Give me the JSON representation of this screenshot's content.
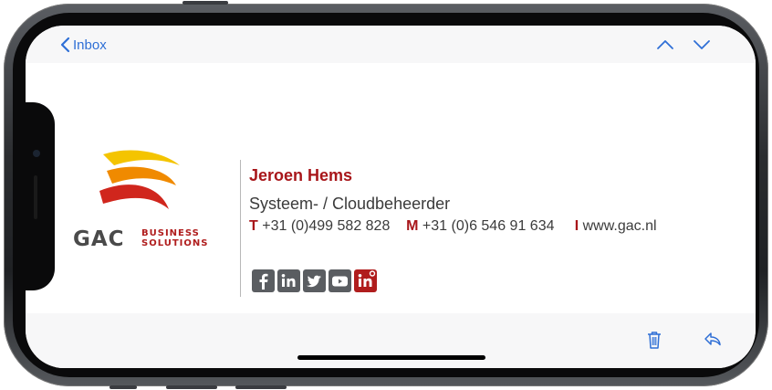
{
  "header": {
    "back_label": "Inbox"
  },
  "signature": {
    "name": "Jeroen Hems",
    "role": "Systeem- / Cloudbeheerder",
    "phone_key": "T",
    "phone": "+31 (0)499 582 828",
    "mobile_key": "M",
    "mobile": "+31 (0)6 546 91 634",
    "web_key": "I",
    "web": "www.gac.nl",
    "logo": {
      "main": "GAC",
      "sub_line1": "BUSINESS",
      "sub_line2": "SOLUTIONS"
    },
    "social": [
      {
        "icon": "facebook-icon",
        "color": "#5a5d61"
      },
      {
        "icon": "linkedin-icon",
        "color": "#5a5d61"
      },
      {
        "icon": "twitter-icon",
        "color": "#5a5d61"
      },
      {
        "icon": "youtube-icon",
        "color": "#5a5d61"
      },
      {
        "icon": "linkedin-company-icon",
        "color": "#b01d1d"
      }
    ]
  },
  "toolbar": {
    "trash_icon": "trash-icon",
    "reply_icon": "reply-icon"
  },
  "colors": {
    "accent": "#2f6fd6",
    "brand_red": "#a8161a",
    "text": "#3b3b3b"
  }
}
